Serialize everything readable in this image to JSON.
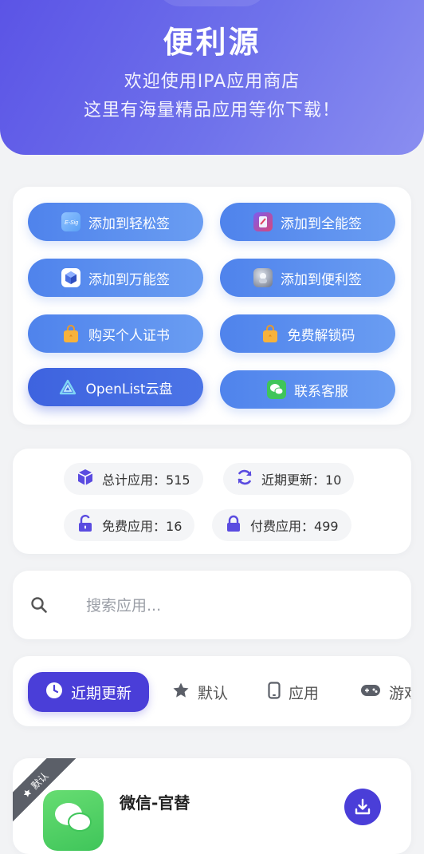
{
  "header": {
    "title": "便利源",
    "subtitle_line1": "欢迎使用IPA应用商店",
    "subtitle_line2": "这里有海量精品应用等你下载！"
  },
  "quick_buttons": [
    {
      "label": "添加到轻松签",
      "icon": "qingsong-app-icon"
    },
    {
      "label": "添加到全能签",
      "icon": "quanneng-app-icon"
    },
    {
      "label": "添加到万能签",
      "icon": "wanneng-app-icon"
    },
    {
      "label": "添加到便利签",
      "icon": "bianli-app-icon"
    },
    {
      "label": "购买个人证书",
      "icon": "shopping-bag-icon"
    },
    {
      "label": "免费解锁码",
      "icon": "shopping-bag-icon"
    },
    {
      "label": "OpenList云盘",
      "icon": "openlist-icon"
    },
    {
      "label": "联系客服",
      "icon": "wechat-icon"
    }
  ],
  "stats": [
    {
      "label": "总计应用：",
      "value": "515",
      "icon": "cube-icon"
    },
    {
      "label": "近期更新：",
      "value": "10",
      "icon": "refresh-icon"
    },
    {
      "label": "免费应用：",
      "value": "16",
      "icon": "unlock-icon"
    },
    {
      "label": "付费应用：",
      "value": "499",
      "icon": "lock-icon"
    }
  ],
  "search": {
    "placeholder": "搜索应用...",
    "value": ""
  },
  "tabs": [
    {
      "label": "近期更新",
      "icon": "clock-icon",
      "active": true
    },
    {
      "label": "默认",
      "icon": "star-icon",
      "active": false
    },
    {
      "label": "应用",
      "icon": "phone-icon",
      "active": false
    },
    {
      "label": "游戏",
      "icon": "gamepad-icon",
      "active": false
    }
  ],
  "app_list": [
    {
      "name": "微信-官替",
      "badge": "默认",
      "icon": "wechat-icon"
    }
  ],
  "colors": {
    "header_gradient_start": "#5b54e6",
    "header_gradient_end": "#8a8ef0",
    "button_blue": "#5a8fee",
    "accent_purple": "#4a3ed8",
    "stat_icon": "#5a4be0",
    "wechat_green": "#3fc55a"
  }
}
